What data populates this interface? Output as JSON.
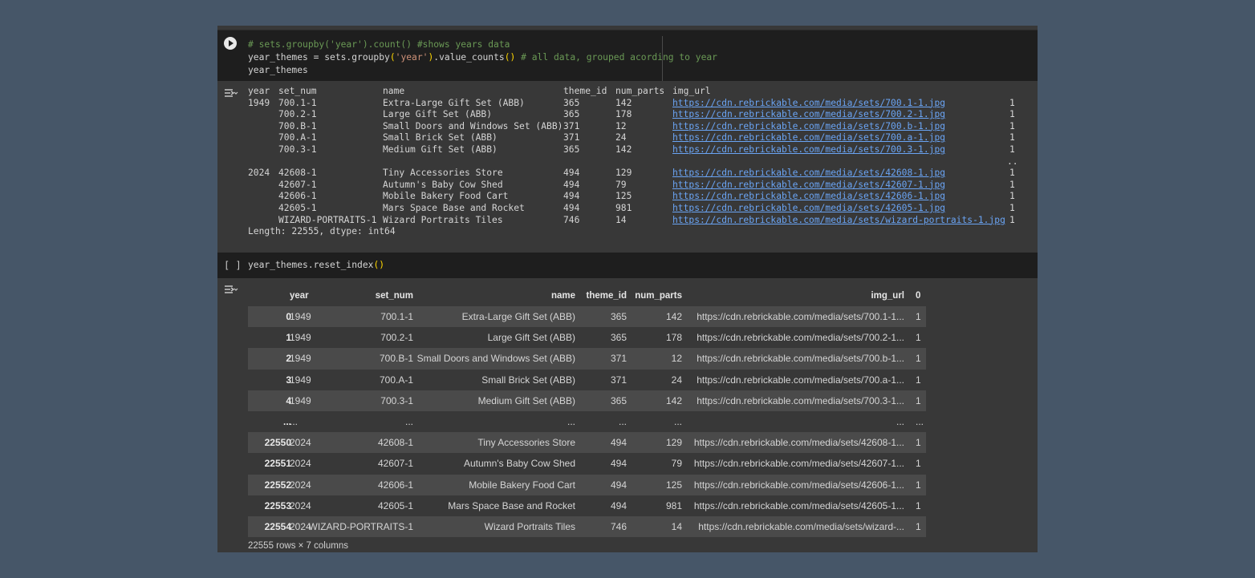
{
  "cell1": {
    "lines": [
      "# sets.groupby('year').count() #shows years data",
      "year_themes = sets.groupby('year').value_counts() # all data, grouped acording to year",
      "year_themes"
    ]
  },
  "series_output": {
    "header": {
      "year": "year",
      "set_num": "set_num",
      "name": "name",
      "theme_id": "theme_id",
      "num_parts": "num_parts",
      "img_url": "img_url"
    },
    "rows": [
      {
        "year": "1949",
        "set_num": "700.1-1",
        "name": "Extra-Large Gift Set (ABB)",
        "theme_id": "365",
        "num_parts": "142",
        "img_url": "https://cdn.rebrickable.com/media/sets/700.1-1.jpg",
        "count": "1"
      },
      {
        "year": "",
        "set_num": "700.2-1",
        "name": "Large Gift Set (ABB)",
        "theme_id": "365",
        "num_parts": "178",
        "img_url": "https://cdn.rebrickable.com/media/sets/700.2-1.jpg",
        "count": "1"
      },
      {
        "year": "",
        "set_num": "700.B-1",
        "name": "Small Doors and Windows Set (ABB)",
        "theme_id": "371",
        "num_parts": "12",
        "img_url": "https://cdn.rebrickable.com/media/sets/700.b-1.jpg",
        "count": "1"
      },
      {
        "year": "",
        "set_num": "700.A-1",
        "name": "Small Brick Set (ABB)",
        "theme_id": "371",
        "num_parts": "24",
        "img_url": "https://cdn.rebrickable.com/media/sets/700.a-1.jpg",
        "count": "1"
      },
      {
        "year": "",
        "set_num": "700.3-1",
        "name": "Medium Gift Set (ABB)",
        "theme_id": "365",
        "num_parts": "142",
        "img_url": "https://cdn.rebrickable.com/media/sets/700.3-1.jpg",
        "count": "1"
      },
      {
        "year": "",
        "set_num": "",
        "name": "",
        "theme_id": "",
        "num_parts": "",
        "img_url": "",
        "count": ".."
      },
      {
        "year": "2024",
        "set_num": "42608-1",
        "name": "Tiny Accessories Store",
        "theme_id": "494",
        "num_parts": "129",
        "img_url": "https://cdn.rebrickable.com/media/sets/42608-1.jpg",
        "count": "1"
      },
      {
        "year": "",
        "set_num": "42607-1",
        "name": "Autumn's Baby Cow Shed",
        "theme_id": "494",
        "num_parts": "79",
        "img_url": "https://cdn.rebrickable.com/media/sets/42607-1.jpg",
        "count": "1"
      },
      {
        "year": "",
        "set_num": "42606-1",
        "name": "Mobile Bakery Food Cart",
        "theme_id": "494",
        "num_parts": "125",
        "img_url": "https://cdn.rebrickable.com/media/sets/42606-1.jpg",
        "count": "1"
      },
      {
        "year": "",
        "set_num": "42605-1",
        "name": "Mars Space Base and Rocket",
        "theme_id": "494",
        "num_parts": "981",
        "img_url": "https://cdn.rebrickable.com/media/sets/42605-1.jpg",
        "count": "1"
      },
      {
        "year": "",
        "set_num": "WIZARD-PORTRAITS-1",
        "name": "Wizard Portraits Tiles",
        "theme_id": "746",
        "num_parts": "14",
        "img_url": "https://cdn.rebrickable.com/media/sets/wizard-portraits-1.jpg",
        "count": "1"
      }
    ],
    "footer": "Length: 22555, dtype: int64"
  },
  "cell2": {
    "bracket": "[ ]",
    "code_prefix": "year_themes.reset_index",
    "code_paren": "()"
  },
  "dataframe": {
    "header": {
      "year": "year",
      "set_num": "set_num",
      "name": "name",
      "theme_id": "theme_id",
      "num_parts": "num_parts",
      "img_url": "img_url",
      "zero": "0"
    },
    "rows": [
      {
        "idx": "0",
        "year": "1949",
        "set_num": "700.1-1",
        "name": "Extra-Large Gift Set (ABB)",
        "theme_id": "365",
        "num_parts": "142",
        "img_url": "https://cdn.rebrickable.com/media/sets/700.1-1...",
        "zero": "1"
      },
      {
        "idx": "1",
        "year": "1949",
        "set_num": "700.2-1",
        "name": "Large Gift Set (ABB)",
        "theme_id": "365",
        "num_parts": "178",
        "img_url": "https://cdn.rebrickable.com/media/sets/700.2-1...",
        "zero": "1"
      },
      {
        "idx": "2",
        "year": "1949",
        "set_num": "700.B-1",
        "name": "Small Doors and Windows Set (ABB)",
        "theme_id": "371",
        "num_parts": "12",
        "img_url": "https://cdn.rebrickable.com/media/sets/700.b-1...",
        "zero": "1"
      },
      {
        "idx": "3",
        "year": "1949",
        "set_num": "700.A-1",
        "name": "Small Brick Set (ABB)",
        "theme_id": "371",
        "num_parts": "24",
        "img_url": "https://cdn.rebrickable.com/media/sets/700.a-1...",
        "zero": "1"
      },
      {
        "idx": "4",
        "year": "1949",
        "set_num": "700.3-1",
        "name": "Medium Gift Set (ABB)",
        "theme_id": "365",
        "num_parts": "142",
        "img_url": "https://cdn.rebrickable.com/media/sets/700.3-1...",
        "zero": "1"
      },
      {
        "idx": "...",
        "year": "...",
        "set_num": "...",
        "name": "...",
        "theme_id": "...",
        "num_parts": "...",
        "img_url": "...",
        "zero": "..."
      },
      {
        "idx": "22550",
        "year": "2024",
        "set_num": "42608-1",
        "name": "Tiny Accessories Store",
        "theme_id": "494",
        "num_parts": "129",
        "img_url": "https://cdn.rebrickable.com/media/sets/42608-1...",
        "zero": "1"
      },
      {
        "idx": "22551",
        "year": "2024",
        "set_num": "42607-1",
        "name": "Autumn's Baby Cow Shed",
        "theme_id": "494",
        "num_parts": "79",
        "img_url": "https://cdn.rebrickable.com/media/sets/42607-1...",
        "zero": "1"
      },
      {
        "idx": "22552",
        "year": "2024",
        "set_num": "42606-1",
        "name": "Mobile Bakery Food Cart",
        "theme_id": "494",
        "num_parts": "125",
        "img_url": "https://cdn.rebrickable.com/media/sets/42606-1...",
        "zero": "1"
      },
      {
        "idx": "22553",
        "year": "2024",
        "set_num": "42605-1",
        "name": "Mars Space Base and Rocket",
        "theme_id": "494",
        "num_parts": "981",
        "img_url": "https://cdn.rebrickable.com/media/sets/42605-1...",
        "zero": "1"
      },
      {
        "idx": "22554",
        "year": "2024",
        "set_num": "WIZARD-PORTRAITS-1",
        "name": "Wizard Portraits Tiles",
        "theme_id": "746",
        "num_parts": "14",
        "img_url": "https://cdn.rebrickable.com/media/sets/wizard-...",
        "zero": "1"
      }
    ],
    "footer": "22555 rows × 7 columns"
  },
  "icons": {
    "run": "play-circle-icon",
    "output": "output-toggle-icon"
  },
  "colors": {
    "page_bg": "#465668",
    "cell_bg": "#1e1e1e",
    "output_bg": "#383838",
    "link": "#6aa4f4",
    "comment": "#6a9955",
    "string": "#ce9178"
  }
}
